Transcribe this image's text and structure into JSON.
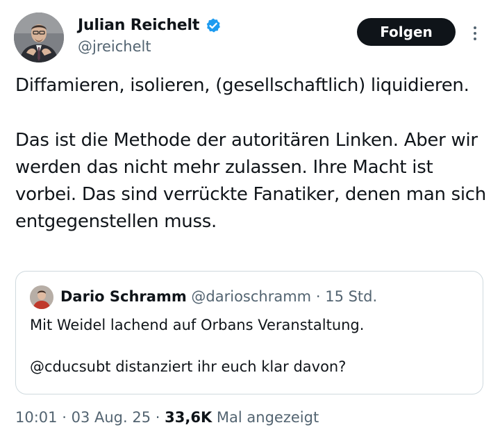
{
  "author": {
    "display_name": "Julian Reichelt",
    "handle": "@jreichelt",
    "verified": true,
    "avatar_icon": "profile-photo-man-in-suit"
  },
  "actions": {
    "follow_label": "Folgen",
    "more_icon": "more-vertical-icon"
  },
  "tweet": {
    "paragraphs": [
      "Diffamieren, isolieren, (gesellschaftlich) liquidieren.",
      "Das ist die Methode der autoritären Linken. Aber wir werden das nicht mehr zulassen. Ihre Macht ist vorbei. Das sind verrückte Fanatiker, denen man sich entgegenstellen muss."
    ]
  },
  "quoted_tweet": {
    "display_name": "Dario Schramm",
    "handle": "@darioschramm",
    "separator": "·",
    "time_ago": "15 Std.",
    "avatar_icon": "profile-photo-man-red-shirt",
    "paragraphs": [
      "Mit Weidel lachend auf Orbans Veranstaltung.",
      "@cducsubt distanziert ihr euch klar davon?"
    ]
  },
  "meta": {
    "time": "10:01",
    "separator": "·",
    "date": "03 Aug. 25",
    "views_count": "33,6K",
    "views_label": "Mal angezeigt"
  },
  "colors": {
    "text_primary": "#0f1419",
    "text_secondary": "#536471",
    "verified_blue": "#1d9bf0",
    "button_bg": "#0f1419",
    "border": "#cfd9de"
  }
}
